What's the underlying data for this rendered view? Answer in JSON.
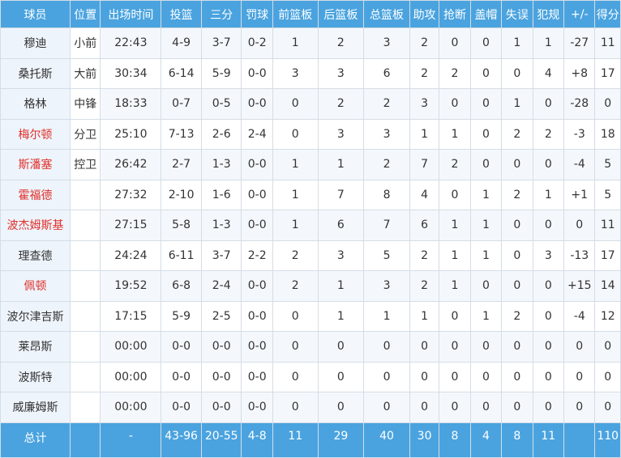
{
  "headers": [
    "球员",
    "位置",
    "出场时间",
    "投篮",
    "三分",
    "罚球",
    "前篮板",
    "后篮板",
    "总篮板",
    "助攻",
    "抢断",
    "盖帽",
    "失误",
    "犯规",
    "+/-",
    "得分"
  ],
  "players": [
    {
      "name": "穆迪",
      "pos": "小前",
      "min": "22:43",
      "fg": "4-9",
      "tp": "3-7",
      "ft": "0-2",
      "oreb": "1",
      "dreb": "2",
      "reb": "3",
      "ast": "2",
      "stl": "0",
      "blk": "0",
      "tov": "1",
      "pf": "1",
      "pm": "-27",
      "pts": "11",
      "highlight": false
    },
    {
      "name": "桑托斯",
      "pos": "大前",
      "min": "30:34",
      "fg": "6-14",
      "tp": "5-9",
      "ft": "0-0",
      "oreb": "3",
      "dreb": "3",
      "reb": "6",
      "ast": "2",
      "stl": "2",
      "blk": "0",
      "tov": "0",
      "pf": "4",
      "pm": "+8",
      "pts": "17",
      "highlight": false
    },
    {
      "name": "格林",
      "pos": "中锋",
      "min": "18:33",
      "fg": "0-7",
      "tp": "0-5",
      "ft": "0-0",
      "oreb": "0",
      "dreb": "2",
      "reb": "2",
      "ast": "3",
      "stl": "0",
      "blk": "0",
      "tov": "1",
      "pf": "0",
      "pm": "-28",
      "pts": "0",
      "highlight": false
    },
    {
      "name": "梅尔顿",
      "pos": "分卫",
      "min": "25:10",
      "fg": "7-13",
      "tp": "2-6",
      "ft": "2-4",
      "oreb": "0",
      "dreb": "3",
      "reb": "3",
      "ast": "1",
      "stl": "1",
      "blk": "0",
      "tov": "2",
      "pf": "2",
      "pm": "-3",
      "pts": "18",
      "highlight": true
    },
    {
      "name": "斯潘塞",
      "pos": "控卫",
      "min": "26:42",
      "fg": "2-7",
      "tp": "1-3",
      "ft": "0-0",
      "oreb": "1",
      "dreb": "1",
      "reb": "2",
      "ast": "7",
      "stl": "2",
      "blk": "0",
      "tov": "0",
      "pf": "0",
      "pm": "-4",
      "pts": "5",
      "highlight": true
    },
    {
      "name": "霍福德",
      "pos": "",
      "min": "27:32",
      "fg": "2-10",
      "tp": "1-6",
      "ft": "0-0",
      "oreb": "1",
      "dreb": "7",
      "reb": "8",
      "ast": "4",
      "stl": "0",
      "blk": "1",
      "tov": "2",
      "pf": "1",
      "pm": "+1",
      "pts": "5",
      "highlight": true
    },
    {
      "name": "波杰姆斯基",
      "pos": "",
      "min": "27:15",
      "fg": "5-8",
      "tp": "1-3",
      "ft": "0-0",
      "oreb": "1",
      "dreb": "6",
      "reb": "7",
      "ast": "6",
      "stl": "1",
      "blk": "1",
      "tov": "0",
      "pf": "0",
      "pm": "0",
      "pts": "11",
      "highlight": true
    },
    {
      "name": "理查德",
      "pos": "",
      "min": "24:24",
      "fg": "6-11",
      "tp": "3-7",
      "ft": "2-2",
      "oreb": "2",
      "dreb": "3",
      "reb": "5",
      "ast": "2",
      "stl": "1",
      "blk": "1",
      "tov": "0",
      "pf": "3",
      "pm": "-13",
      "pts": "17",
      "highlight": false
    },
    {
      "name": "佩顿",
      "pos": "",
      "min": "19:52",
      "fg": "6-8",
      "tp": "2-4",
      "ft": "0-0",
      "oreb": "2",
      "dreb": "1",
      "reb": "3",
      "ast": "2",
      "stl": "1",
      "blk": "0",
      "tov": "0",
      "pf": "0",
      "pm": "+15",
      "pts": "14",
      "highlight": true
    },
    {
      "name": "波尔津吉斯",
      "pos": "",
      "min": "17:15",
      "fg": "5-9",
      "tp": "2-5",
      "ft": "0-0",
      "oreb": "0",
      "dreb": "1",
      "reb": "1",
      "ast": "1",
      "stl": "0",
      "blk": "1",
      "tov": "2",
      "pf": "0",
      "pm": "-4",
      "pts": "12",
      "highlight": false
    },
    {
      "name": "莱昂斯",
      "pos": "",
      "min": "00:00",
      "fg": "0-0",
      "tp": "0-0",
      "ft": "0-0",
      "oreb": "0",
      "dreb": "0",
      "reb": "0",
      "ast": "0",
      "stl": "0",
      "blk": "0",
      "tov": "0",
      "pf": "0",
      "pm": "0",
      "pts": "0",
      "highlight": false
    },
    {
      "name": "波斯特",
      "pos": "",
      "min": "00:00",
      "fg": "0-0",
      "tp": "0-0",
      "ft": "0-0",
      "oreb": "0",
      "dreb": "0",
      "reb": "0",
      "ast": "0",
      "stl": "0",
      "blk": "0",
      "tov": "0",
      "pf": "0",
      "pm": "0",
      "pts": "0",
      "highlight": false
    },
    {
      "name": "威廉姆斯",
      "pos": "",
      "min": "00:00",
      "fg": "0-0",
      "tp": "0-0",
      "ft": "0-0",
      "oreb": "0",
      "dreb": "0",
      "reb": "0",
      "ast": "0",
      "stl": "0",
      "blk": "0",
      "tov": "0",
      "pf": "0",
      "pm": "0",
      "pts": "0",
      "highlight": false
    }
  ],
  "totals": {
    "name": "总计",
    "pos": "",
    "min": "-",
    "fg": "43-96",
    "tp": "20-55",
    "ft": "4-8",
    "oreb": "11",
    "dreb": "29",
    "reb": "40",
    "ast": "30",
    "stl": "8",
    "blk": "4",
    "tov": "8",
    "pf": "11",
    "pm": "",
    "pts": "110"
  },
  "colors": {
    "header_bg": "#4aa3df",
    "highlight_text": "#e0312b",
    "grid": "#d4dde6"
  }
}
